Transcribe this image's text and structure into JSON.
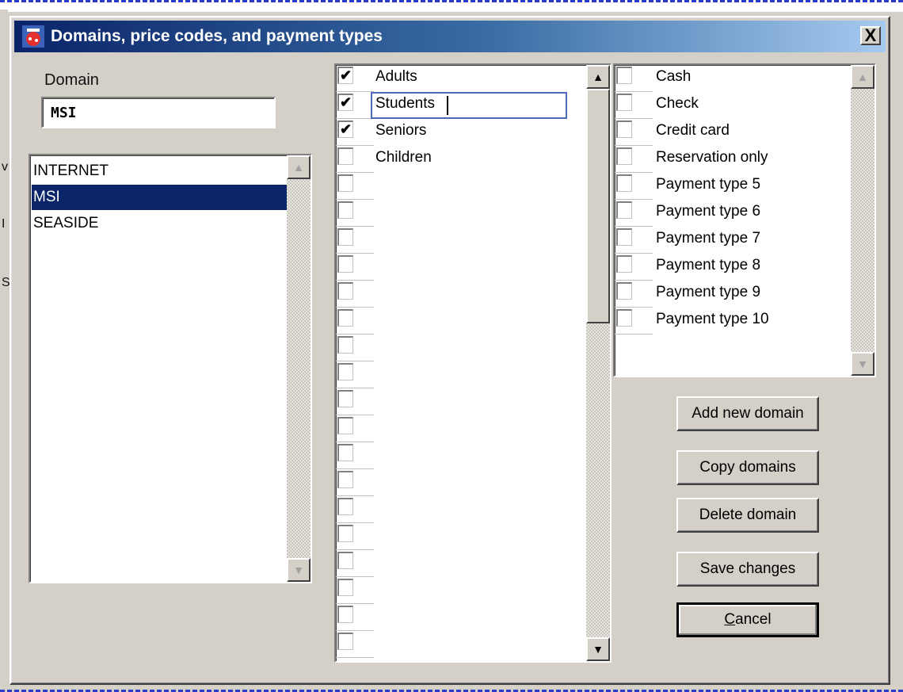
{
  "window": {
    "title": "Domains, price codes, and payment types",
    "close_label": "X"
  },
  "domain": {
    "label": "Domain",
    "value": "MSI"
  },
  "domains": [
    {
      "name": "INTERNET",
      "selected": false
    },
    {
      "name": "MSI",
      "selected": true
    },
    {
      "name": "SEASIDE",
      "selected": false
    }
  ],
  "price_codes": [
    {
      "label": "Adults",
      "checked": true
    },
    {
      "label": "Students",
      "checked": true,
      "editing": true
    },
    {
      "label": "Seniors",
      "checked": true
    },
    {
      "label": "Children",
      "checked": false
    },
    {
      "label": "",
      "checked": false
    },
    {
      "label": "",
      "checked": false
    },
    {
      "label": "",
      "checked": false
    },
    {
      "label": "",
      "checked": false
    },
    {
      "label": "",
      "checked": false
    },
    {
      "label": "",
      "checked": false
    },
    {
      "label": "",
      "checked": false
    },
    {
      "label": "",
      "checked": false
    },
    {
      "label": "",
      "checked": false
    },
    {
      "label": "",
      "checked": false
    },
    {
      "label": "",
      "checked": false
    },
    {
      "label": "",
      "checked": false
    },
    {
      "label": "",
      "checked": false
    },
    {
      "label": "",
      "checked": false
    },
    {
      "label": "",
      "checked": false
    },
    {
      "label": "",
      "checked": false
    },
    {
      "label": "",
      "checked": false
    },
    {
      "label": "",
      "checked": false
    }
  ],
  "payment_types": [
    {
      "label": "Cash",
      "checked": false
    },
    {
      "label": "Check",
      "checked": false
    },
    {
      "label": "Credit card",
      "checked": false
    },
    {
      "label": "Reservation only",
      "checked": false
    },
    {
      "label": "Payment type  5",
      "checked": false
    },
    {
      "label": "Payment type  6",
      "checked": false
    },
    {
      "label": "Payment type  7",
      "checked": false
    },
    {
      "label": "Payment type  8",
      "checked": false
    },
    {
      "label": "Payment type  9",
      "checked": false
    },
    {
      "label": "Payment type 10",
      "checked": false
    }
  ],
  "buttons": {
    "add_new_domain": "Add new domain",
    "copy_domains": "Copy domains",
    "delete_domain": "Delete domain",
    "save_changes": "Save changes",
    "cancel_mnemonic": "C",
    "cancel_rest": "ancel"
  },
  "background_fragments": [
    "v",
    "I",
    "S"
  ],
  "icons": {
    "scroll_up": "scroll-up-arrow",
    "scroll_down": "scroll-down-arrow",
    "checkmark": "checkmark",
    "app": "app-icon"
  },
  "colors": {
    "title_gradient_start": "#0a246a",
    "title_gradient_end": "#a6caf0",
    "selection": "#0a246a",
    "face": "#d4d0c8",
    "edit_border": "#4d6bb5"
  },
  "glyphs": {
    "check": "✔",
    "up": "▲",
    "down": "▼"
  }
}
